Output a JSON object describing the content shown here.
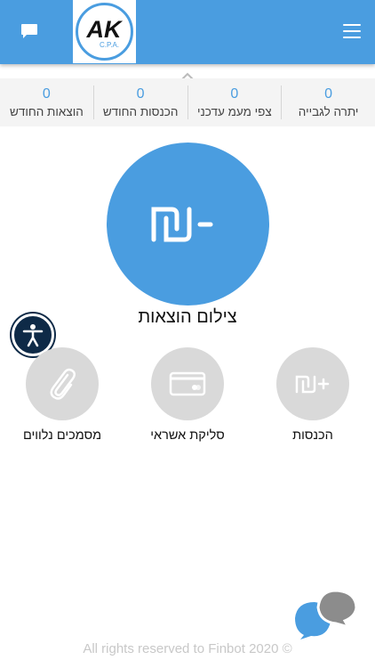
{
  "header": {
    "logo": {
      "letters": "AK",
      "subtitle": "C.P.A."
    },
    "chat_icon": "chat-bubble-icon",
    "menu_icon": "hamburger-menu-icon"
  },
  "stats": [
    {
      "value": "0",
      "label": "יתרה לגבייה"
    },
    {
      "value": "0",
      "label": "צפי מעמ עדכני"
    },
    {
      "value": "0",
      "label": "הכנסות החודש"
    },
    {
      "value": "0",
      "label": "הוצאות החודש"
    }
  ],
  "main_action": {
    "label": "צילום הוצאות",
    "icon": "shekel-minus-icon"
  },
  "actions": [
    {
      "label": "הכנסות",
      "icon": "shekel-plus-icon"
    },
    {
      "label": "סליקת אשראי",
      "icon": "credit-card-icon"
    },
    {
      "label": "מסמכים נלווים",
      "icon": "paperclip-icon"
    }
  ],
  "footer": {
    "text": "All rights reserved to Finbot 2020 ©"
  },
  "colors": {
    "primary": "#4a9de0",
    "grey_circle": "#d9d9d9",
    "a11y": "#0e2a47"
  }
}
